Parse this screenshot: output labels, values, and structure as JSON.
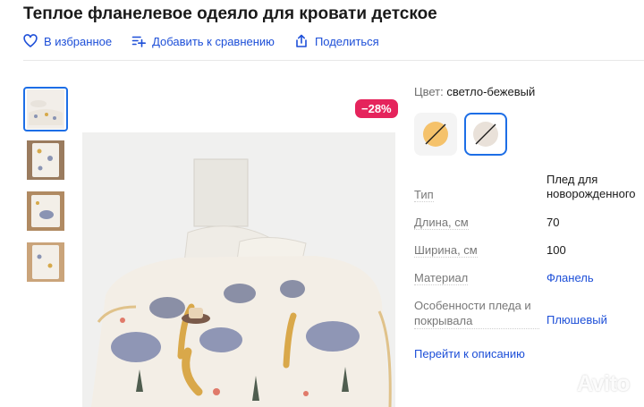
{
  "product": {
    "title": "Теплое фланелевое одеяло для кровати детское",
    "discount": "−28%"
  },
  "actions": {
    "favorite": "В избранное",
    "compare": "Добавить к сравнению",
    "share": "Поделиться"
  },
  "color": {
    "label": "Цвет:",
    "value": "светло-бежевый",
    "options": [
      {
        "name": "orange",
        "hex": "#f5c26b"
      },
      {
        "name": "light-beige",
        "hex": "#e9e1d9",
        "selected": true
      }
    ]
  },
  "specs": [
    {
      "key": "Тип",
      "value": "Плед для новорожденного",
      "link": false
    },
    {
      "key": "Длина, см",
      "value": "70",
      "link": false
    },
    {
      "key": "Ширина, см",
      "value": "100",
      "link": false
    },
    {
      "key": "Материал",
      "value": "Фланель",
      "link": true
    },
    {
      "key": "Особенности пледа и покрывала",
      "value": "Плюшевый",
      "link": true
    }
  ],
  "to_description": "Перейти к описанию",
  "watermark": "Avito",
  "colors": {
    "link": "#1d4fd8",
    "accent": "#1d6ee6",
    "discount": "#e5245c"
  }
}
